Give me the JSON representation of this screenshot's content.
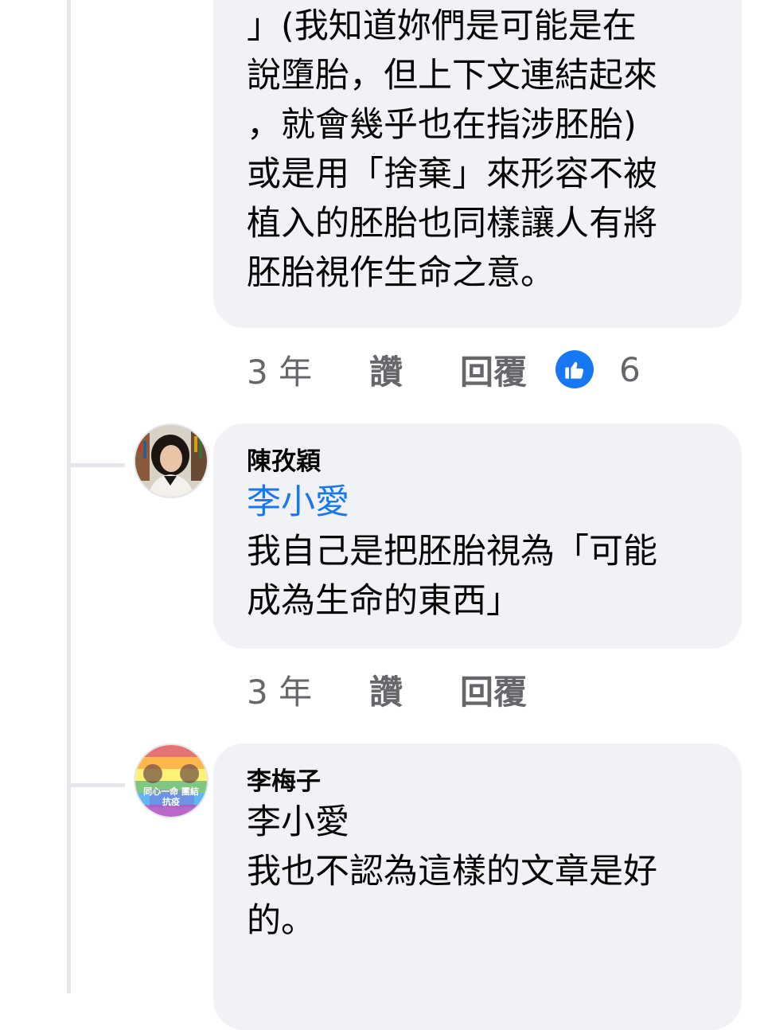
{
  "comments": [
    {
      "lines": [
        "」(我知道妳們是可能是在",
        "說墮胎，但上下文連結起來",
        "，就會幾乎也在指涉胚胎)",
        "或是用「捨棄」來形容不被",
        "植入的胚胎也同樣讓人有將",
        "胚胎視作生命之意。"
      ],
      "actions": {
        "time": "3 年",
        "like": "讚",
        "reply": "回覆"
      },
      "reactions": {
        "icon": "like-icon",
        "count": "6"
      }
    },
    {
      "author": "陳孜穎",
      "mention": "李小愛",
      "lines": [
        "我自己是把胚胎視為「可能",
        "成為生命的東西」"
      ],
      "actions": {
        "time": "3 年",
        "like": "讚",
        "reply": "回覆"
      }
    },
    {
      "author": "李梅子",
      "mention": "李小愛",
      "lines": [
        "我也不認為這樣的文章是好",
        "的。"
      ],
      "avatar_text": "同心一命 團結抗疫"
    }
  ],
  "colors": {
    "link": "#1877f2",
    "bubble": "#f0f2f5",
    "meta": "#65676b",
    "thread": "#e4e6eb"
  }
}
